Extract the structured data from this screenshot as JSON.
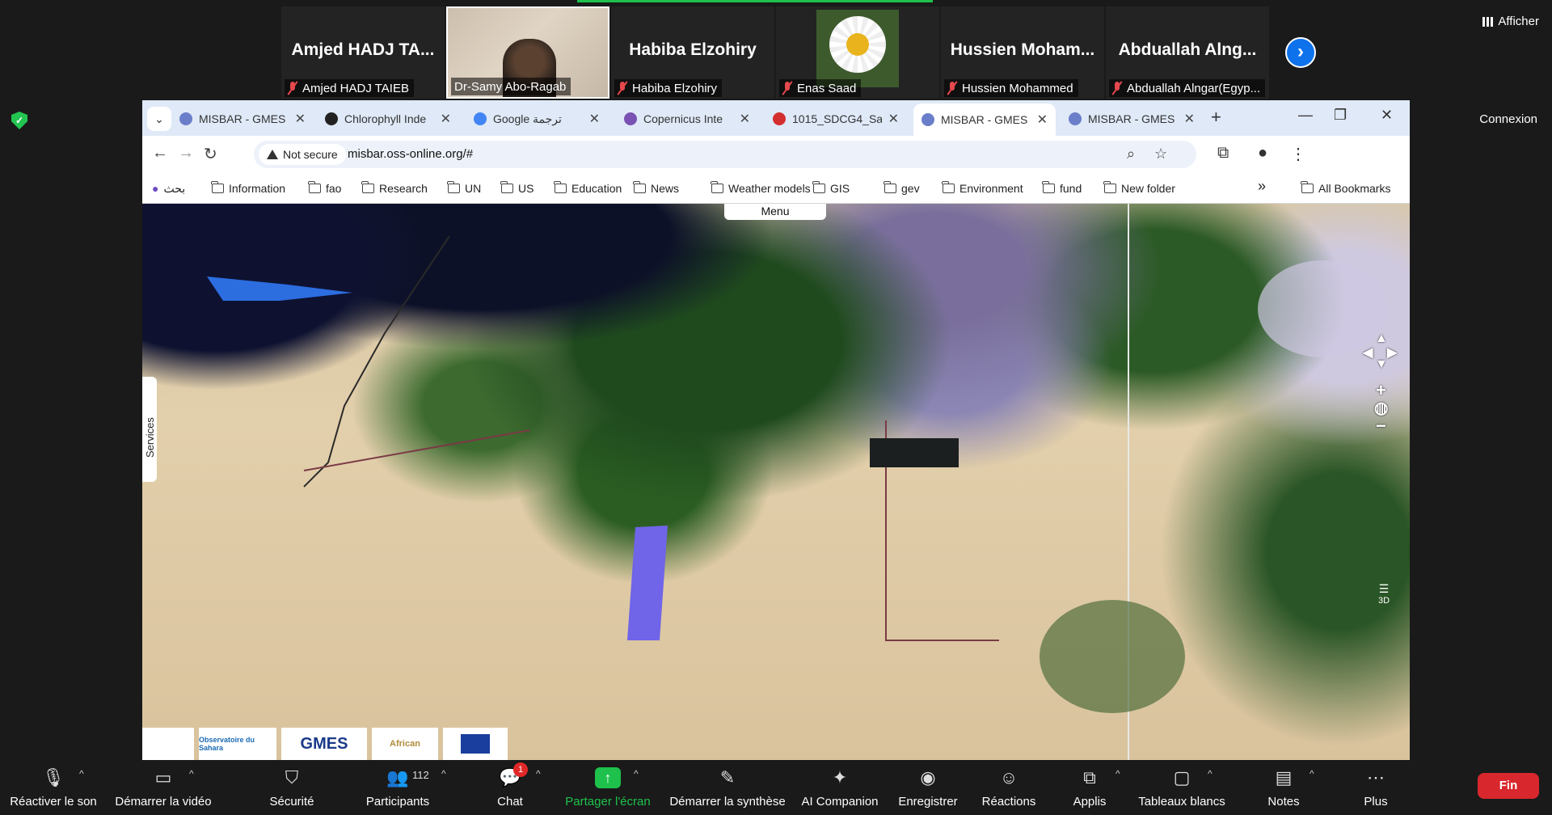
{
  "gallery": {
    "tiles": [
      {
        "kind": "name",
        "big_name": "Amjed HADJ TA...",
        "label": "Amjed HADJ TAIEB",
        "muted": true
      },
      {
        "kind": "video",
        "label": "Dr-Samy Abo-Ragab",
        "muted": false
      },
      {
        "kind": "name",
        "big_name": "Habiba Elzohiry",
        "label": "Habiba Elzohiry",
        "muted": true
      },
      {
        "kind": "flower",
        "label": "Enas Saad",
        "muted": true
      },
      {
        "kind": "name",
        "big_name": "Hussien Moham...",
        "label": "Hussien Mohammed",
        "muted": true
      },
      {
        "kind": "name",
        "big_name": "Abduallah Alng...",
        "label": "Abduallah Alngar(Egyp...",
        "muted": true
      }
    ],
    "next_icon": "chevron-right-icon",
    "view_label": "Afficher"
  },
  "side": {
    "security_icon": "shield-check-icon",
    "connexion_label": "Connexion"
  },
  "browser": {
    "tabs": [
      {
        "title": "MISBAR - GMES",
        "favicon_color": "#6b7ec9",
        "active": false
      },
      {
        "title": "Chlorophyll Inde",
        "favicon_color": "#222222",
        "active": false
      },
      {
        "title": "Google ترجمة",
        "favicon_color": "#4285f4",
        "active": false
      },
      {
        "title": "Copernicus Inte",
        "favicon_color": "#7a52b3",
        "active": false
      },
      {
        "title": "1015_SDCG4_Sa",
        "favicon_color": "#d32f2f",
        "active": false
      },
      {
        "title": "MISBAR - GMES",
        "favicon_color": "#6b7ec9",
        "active": true
      },
      {
        "title": "MISBAR - GMES",
        "favicon_color": "#6b7ec9",
        "active": false
      }
    ],
    "new_tab": "+",
    "window_controls": {
      "minimize": "—",
      "restore": "❐",
      "close": "✕"
    },
    "toolbar": {
      "back": "←",
      "forward": "→",
      "reload": "↻",
      "security_label": "Not secure",
      "url": "misbar.oss-online.org/#",
      "zoom_icon": "zoom-icon",
      "star_icon": "star-icon",
      "extensions_icon": "puzzle-icon",
      "profile_icon": "profile-icon",
      "menu_icon": "kebab-menu-icon"
    },
    "bookmarks": {
      "items": [
        "بحث",
        "Information",
        "fao",
        "Research",
        "UN",
        "US",
        "Education",
        "News",
        "Weather models",
        "GIS",
        "gev",
        "Environment",
        "fund",
        "New folder"
      ],
      "overflow": "»",
      "all_bookmarks": "All Bookmarks"
    }
  },
  "map": {
    "menu_label": "Menu",
    "services_label": "Services",
    "nav": {
      "up": "▲",
      "down": "▼",
      "left": "◀",
      "right": "▶",
      "zoom_in": "+",
      "globe": "◍",
      "zoom_out": "−"
    },
    "side_controls": {
      "layers": "☰",
      "mode_3d": "3D"
    },
    "logos": [
      "",
      "Observatoire du Sahara",
      "GMES",
      "African",
      ""
    ]
  },
  "controls": {
    "items": [
      {
        "label": "Réactiver le son",
        "icon": "mic-off-icon"
      },
      {
        "label": "Démarrer la vidéo",
        "icon": "video-off-icon"
      },
      {
        "label": "Sécurité",
        "icon": "shield-icon"
      },
      {
        "label": "Participants",
        "icon": "participants-icon",
        "count": "112"
      },
      {
        "label": "Chat",
        "icon": "chat-icon",
        "badge": "1"
      },
      {
        "label": "Partager l'écran",
        "icon": "share-screen-icon"
      },
      {
        "label": "Démarrer la synthèse",
        "icon": "summary-icon"
      },
      {
        "label": "AI Companion",
        "icon": "ai-companion-icon"
      },
      {
        "label": "Enregistrer",
        "icon": "record-icon"
      },
      {
        "label": "Réactions",
        "icon": "reactions-icon"
      },
      {
        "label": "Applis",
        "icon": "apps-icon"
      },
      {
        "label": "Tableaux blancs",
        "icon": "whiteboard-icon"
      },
      {
        "label": "Notes",
        "icon": "notes-icon"
      },
      {
        "label": "Plus",
        "icon": "more-icon"
      }
    ],
    "end_label": "Fin",
    "share_color": "#1ec14b",
    "end_color": "#d8282d"
  }
}
